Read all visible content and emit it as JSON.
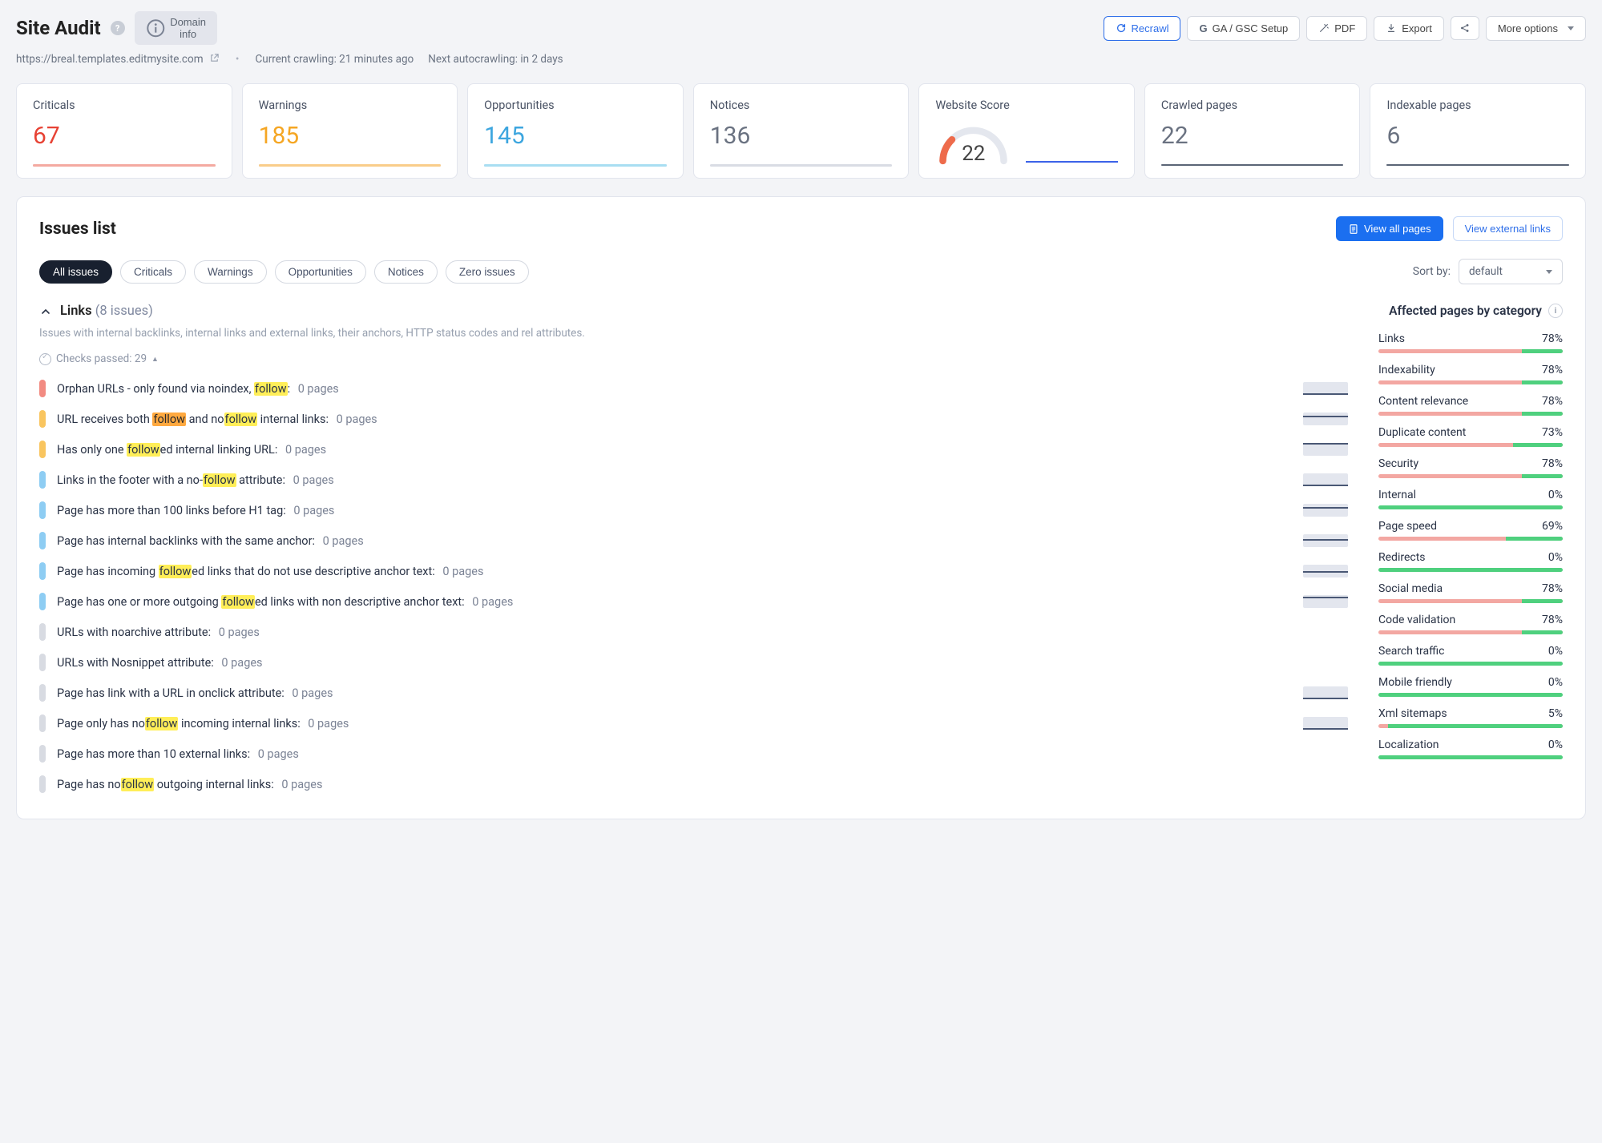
{
  "header": {
    "title": "Site Audit",
    "domain_info_label": "Domain info",
    "url": "https://breal.templates.editmysite.com",
    "crawl_status": "Current crawling: 21 minutes ago",
    "next_autocrawl": "Next autocrawling: in 2 days",
    "buttons": {
      "recrawl": "Recrawl",
      "ga_gsc": "GA / GSC Setup",
      "pdf": "PDF",
      "export": "Export",
      "more": "More options"
    }
  },
  "stats": {
    "criticals": {
      "label": "Criticals",
      "value": "67"
    },
    "warnings": {
      "label": "Warnings",
      "value": "185"
    },
    "opportunities": {
      "label": "Opportunities",
      "value": "145"
    },
    "notices": {
      "label": "Notices",
      "value": "136"
    },
    "score": {
      "label": "Website Score",
      "value": "22"
    },
    "crawled": {
      "label": "Crawled pages",
      "value": "22"
    },
    "indexable": {
      "label": "Indexable pages",
      "value": "6"
    }
  },
  "issues": {
    "title": "Issues list",
    "view_all": "View all pages",
    "view_external": "View external links",
    "filters": {
      "all": "All issues",
      "criticals": "Criticals",
      "warnings": "Warnings",
      "opportunities": "Opportunities",
      "notices": "Notices",
      "zero": "Zero issues"
    },
    "sort_label": "Sort by:",
    "sort_value": "default",
    "group": {
      "name": "Links",
      "count": "(8 issues)",
      "desc": "Issues with internal backlinks, internal links and external links, their anchors, HTTP status codes and rel attributes.",
      "checks_passed": "Checks passed: 29"
    },
    "items": [
      {
        "sev": "red",
        "p1": "Orphan URLs - only found via noindex, ",
        "h1": "follow",
        "p2": ":",
        "pages": "0 pages",
        "chart": true,
        "cpos": "0"
      },
      {
        "sev": "orange",
        "p1": "URL receives both ",
        "h1o": "follow",
        "p2": " and no",
        "h3": "follow",
        "p4": " internal links:",
        "pages": "0 pages",
        "chart": true,
        "cpos": "10"
      },
      {
        "sev": "orange",
        "p1": "Has only one ",
        "h1": "follow",
        "p2": "ed internal linking URL:",
        "pages": "0 pages",
        "chart": true,
        "cpos": "14"
      },
      {
        "sev": "blue",
        "p1": "Links in the footer with a no-",
        "h1": "follow",
        "p2": " attribute:",
        "pages": "0 pages",
        "chart": true,
        "cpos": "0"
      },
      {
        "sev": "blue",
        "p1": "Page has more than 100 links before H1 tag:",
        "pages": "0 pages",
        "chart": true,
        "cpos": "10"
      },
      {
        "sev": "blue",
        "p1": "Page has internal backlinks with the same anchor:",
        "pages": "0 pages",
        "chart": true,
        "cpos": "8"
      },
      {
        "sev": "blue",
        "p1": "Page has incoming ",
        "h1": "follow",
        "p2": "ed links that do not use descriptive anchor text:",
        "pages": "0 pages",
        "chart": true,
        "cpos": "6"
      },
      {
        "sev": "blue",
        "p1": "Page has one or more outgoing ",
        "h1": "follow",
        "p2": "ed links with non descriptive anchor text:",
        "pages": "0 pages",
        "chart": true,
        "cpos": "12"
      },
      {
        "sev": "grey",
        "p1": "URLs with noarchive attribute:",
        "pages": "0 pages",
        "chart": false
      },
      {
        "sev": "grey",
        "p1": "URLs with Nosnippet attribute:",
        "pages": "0 pages",
        "chart": false
      },
      {
        "sev": "grey",
        "p1": "Page has link with a URL in onclick attribute:",
        "pages": "0 pages",
        "chart": true,
        "cpos": "0"
      },
      {
        "sev": "grey",
        "p1": "Page only has no",
        "h1": "follow",
        "p2": " incoming internal links:",
        "pages": "0 pages",
        "chart": true,
        "cpos": "0"
      },
      {
        "sev": "grey",
        "p1": "Page has more than 10 external links:",
        "pages": "0 pages",
        "chart": false
      },
      {
        "sev": "grey",
        "p1": "Page has no",
        "h1": "follow",
        "p2": " outgoing internal links:",
        "pages": "0 pages",
        "chart": false
      }
    ],
    "categories_title": "Affected pages by category",
    "categories": [
      {
        "name": "Links",
        "pct": "78%",
        "green": 22
      },
      {
        "name": "Indexability",
        "pct": "78%",
        "green": 22
      },
      {
        "name": "Content relevance",
        "pct": "78%",
        "green": 22
      },
      {
        "name": "Duplicate content",
        "pct": "73%",
        "green": 27
      },
      {
        "name": "Security",
        "pct": "78%",
        "green": 22
      },
      {
        "name": "Internal",
        "pct": "0%",
        "green": 100
      },
      {
        "name": "Page speed",
        "pct": "69%",
        "green": 31
      },
      {
        "name": "Redirects",
        "pct": "0%",
        "green": 100
      },
      {
        "name": "Social media",
        "pct": "78%",
        "green": 22
      },
      {
        "name": "Code validation",
        "pct": "78%",
        "green": 22
      },
      {
        "name": "Search traffic",
        "pct": "0%",
        "green": 100
      },
      {
        "name": "Mobile friendly",
        "pct": "0%",
        "green": 100
      },
      {
        "name": "Xml sitemaps",
        "pct": "5%",
        "green": 95
      },
      {
        "name": "Localization",
        "pct": "0%",
        "green": 100
      }
    ]
  }
}
